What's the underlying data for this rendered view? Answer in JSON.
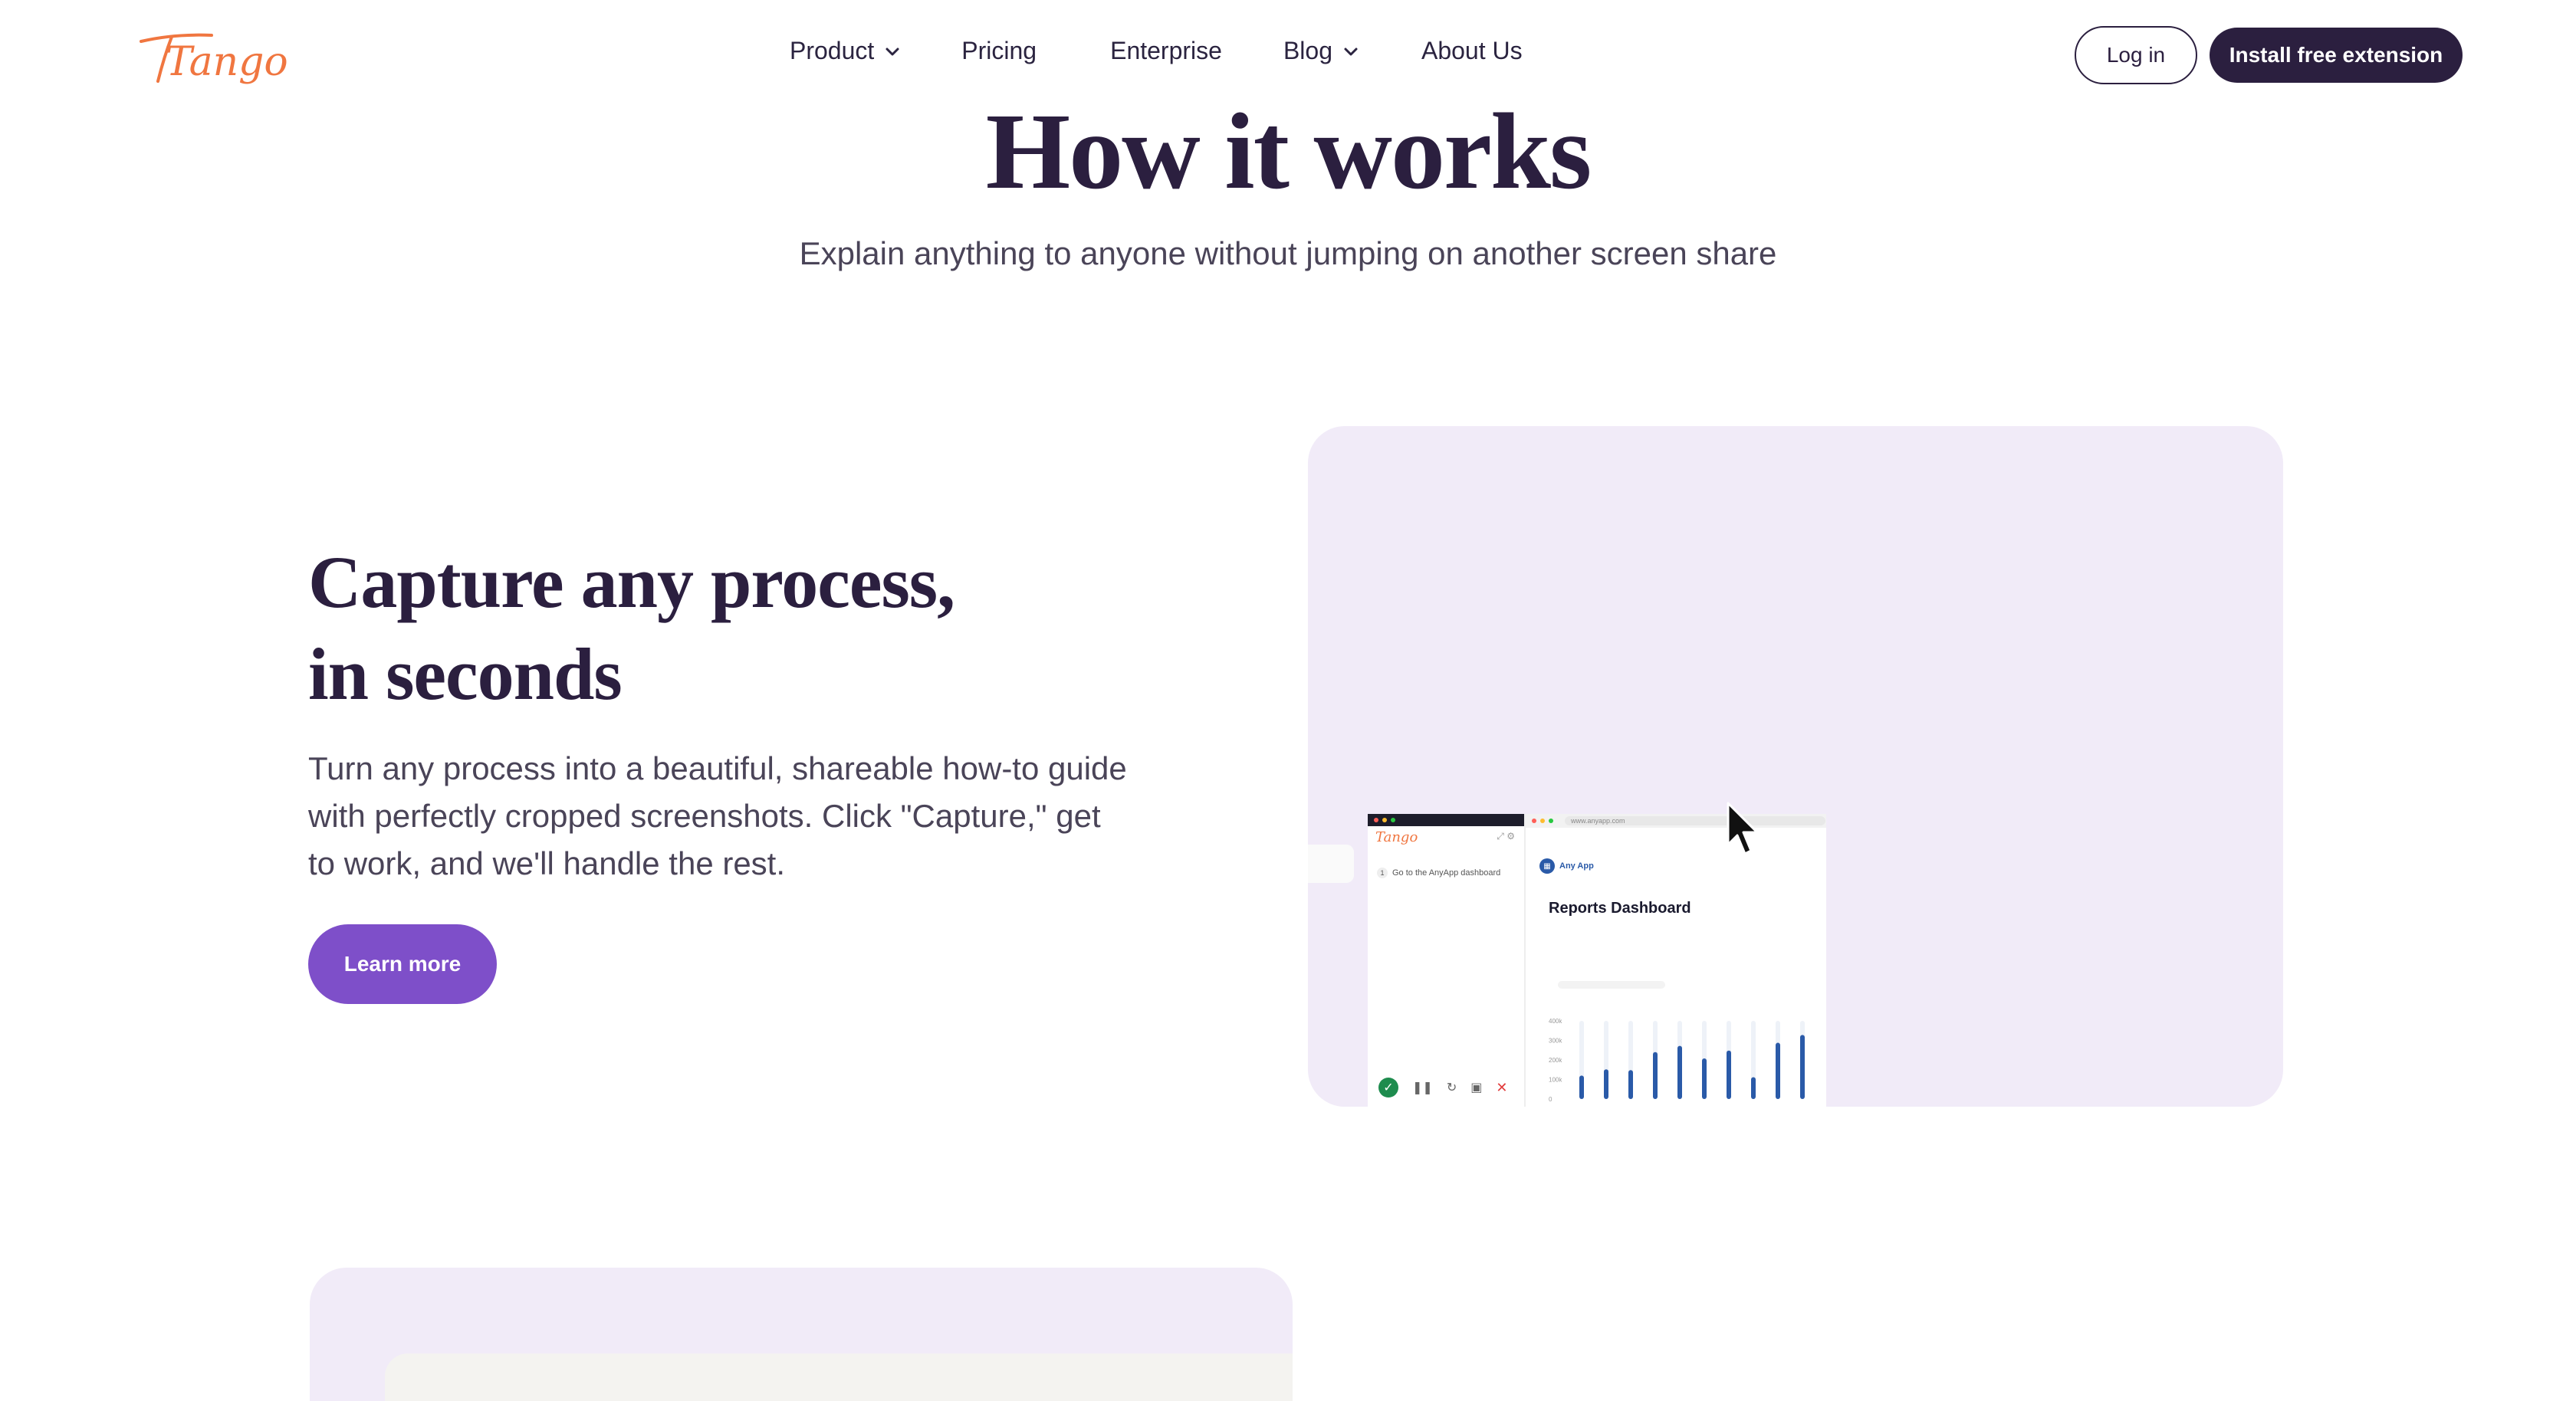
{
  "brand": {
    "logo_text": "Tango",
    "logo_color": "#f07640",
    "primary_dark": "#2b1f3f",
    "accent_purple": "#7e4fc9",
    "panel_bg": "#f1ebf8"
  },
  "nav": {
    "items": [
      {
        "label": "Product",
        "has_dropdown": true
      },
      {
        "label": "Pricing",
        "has_dropdown": false
      },
      {
        "label": "Enterprise",
        "has_dropdown": false
      },
      {
        "label": "Blog",
        "has_dropdown": true
      },
      {
        "label": "About Us",
        "has_dropdown": false
      }
    ],
    "login_label": "Log in",
    "install_label": "Install free extension"
  },
  "hero": {
    "title": "How it works",
    "subtitle": "Explain anything to anyone without jumping on another screen share"
  },
  "feature": {
    "title_line1": "Capture any process,",
    "title_line2": "in seconds",
    "body": "Turn any process into a beautiful, shareable how-to guide with perfectly cropped screenshots. Click \"Capture,\" get to work, and we'll handle the rest.",
    "cta_label": "Learn more"
  },
  "mockup": {
    "sidebar_logo": "Tango",
    "step_number": "1",
    "step_text": "Go to the AnyApp dashboard",
    "url": "www.anyapp.com",
    "app_name": "Any App",
    "report_title": "Reports Dashboard",
    "chart_ticks": [
      "400k",
      "300k",
      "200k",
      "100k",
      "0"
    ],
    "chart_values": [
      0.3,
      0.38,
      0.37,
      0.6,
      0.68,
      0.52,
      0.62,
      0.28,
      0.72,
      0.82
    ],
    "bar_color": "#2a5aa8",
    "controls": [
      "check-icon",
      "pause-icon",
      "restart-icon",
      "stop-icon",
      "close-icon"
    ]
  }
}
